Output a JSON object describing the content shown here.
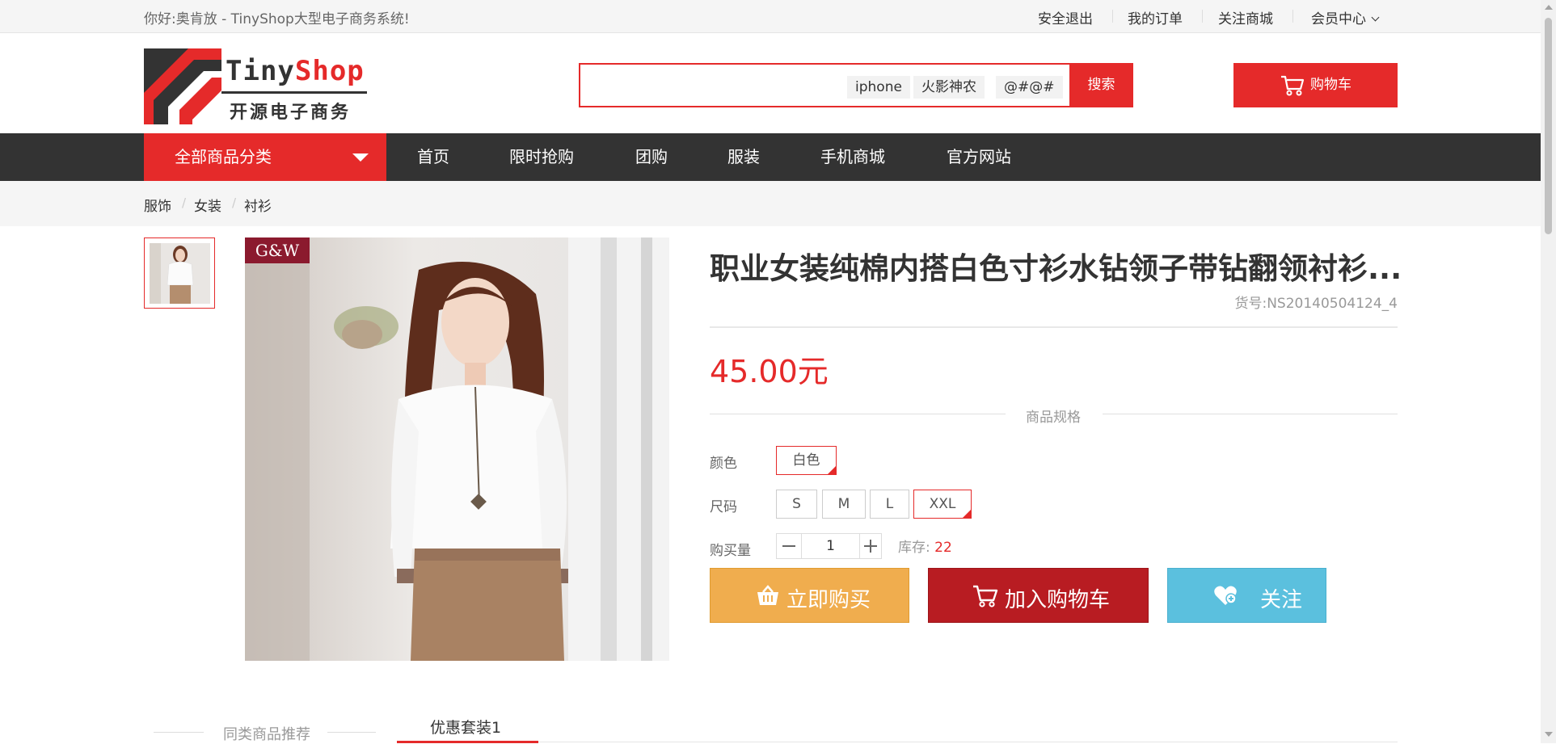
{
  "topbar": {
    "welcome": "你好:奥肯放 - TinyShop大型电子商务系统!",
    "links": [
      "安全退出",
      "我的订单",
      "关注商城",
      "会员中心"
    ]
  },
  "logo": {
    "text_en_a": "Tiny",
    "text_en_b": "Shop",
    "text_cn": "开源电子商务"
  },
  "search": {
    "value": "",
    "hot_words": [
      "iphone",
      "火影神农",
      "@#@#"
    ],
    "button": "搜索"
  },
  "cart": {
    "label": "购物车"
  },
  "nav": {
    "all_categories": "全部商品分类",
    "items": [
      "首页",
      "限时抢购",
      "团购",
      "服装",
      "手机商城",
      "官方网站"
    ]
  },
  "breadcrumb": [
    "服饰",
    "女装",
    "衬衫"
  ],
  "product": {
    "image_brand": "G&W",
    "title": "职业女装纯棉内搭白色寸衫水钻领子带钻翻领衬衫...",
    "sku_label": "货号:",
    "sku": "NS20140504124_4",
    "price": "45.00元",
    "spec_title": "商品规格",
    "color_label": "颜色",
    "colors": [
      "白色"
    ],
    "selected_color": "白色",
    "size_label": "尺码",
    "sizes": [
      "S",
      "M",
      "L",
      "XXL"
    ],
    "selected_size": "XXL",
    "qty_label": "购买量",
    "qty": "1",
    "stock_label": "库存:",
    "stock": "22",
    "buy_now": "立即购买",
    "add_cart": "加入购物车",
    "follow": "关注"
  },
  "tabs": {
    "left": "同类商品推荐",
    "right": "优惠套装1"
  },
  "colors": {
    "accent": "#e52a2a",
    "nav_bg": "#333333",
    "buy": "#f0ad4e",
    "addcart": "#b81c22",
    "follow": "#5bc0de"
  }
}
